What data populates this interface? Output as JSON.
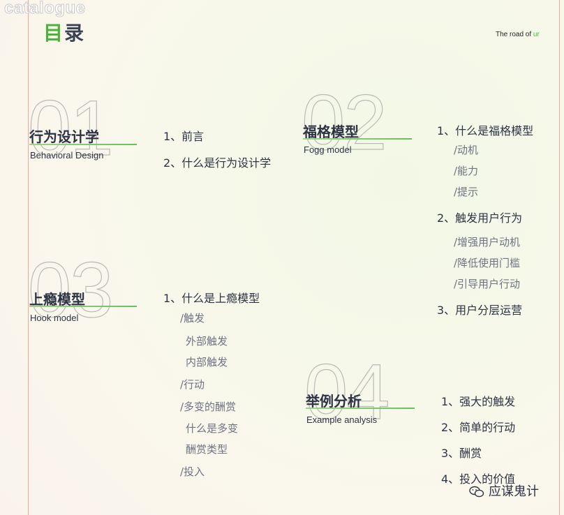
{
  "header": {
    "watermark": "catalogue",
    "title_first": "目",
    "title_rest": "录",
    "tagline_prefix": "The road of ",
    "tagline_highlight": "ur"
  },
  "sections": [
    {
      "number": "01",
      "title": "行为设计学",
      "subtitle": "Behavioral Design",
      "items": [
        "1、前言",
        "2、什么是行为设计学"
      ]
    },
    {
      "number": "02",
      "title": "福格模型",
      "subtitle": "Fogg model",
      "items": [
        "1、什么是福格模型",
        "/动机",
        "/能力",
        "/提示",
        "2、触发用户行为",
        "/增强用户动机",
        "/降低使用门槛",
        "/引导用户行动",
        "3、用户分层运营"
      ]
    },
    {
      "number": "03",
      "title": "上瘾模型",
      "subtitle": "Hook model",
      "items": [
        "1、什么是上瘾模型",
        "/触发",
        "外部触发",
        "内部触发",
        "/行动",
        "/多变的酬赏",
        "什么是多变",
        "酬赏类型",
        "/投入"
      ]
    },
    {
      "number": "04",
      "title": "举例分析",
      "subtitle": "Example analysis",
      "items": [
        "1、强大的触发",
        "2、简单的行动",
        "3、酬赏",
        "4、投入的价值"
      ]
    }
  ],
  "watermark_brand": "应谋鬼计",
  "colors": {
    "accent": "#4bb33a",
    "frame": "#e8a89a",
    "text": "#2d3345"
  }
}
